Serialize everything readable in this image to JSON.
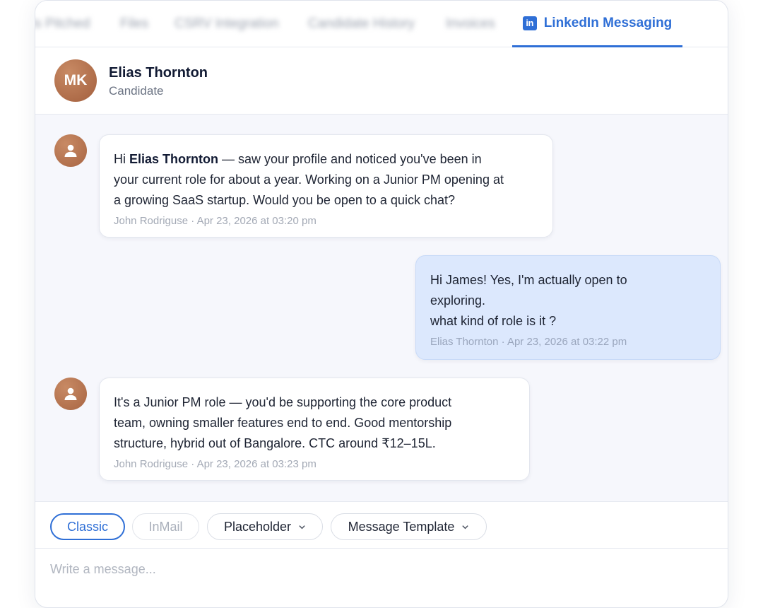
{
  "tabs": {
    "blurred": [
      {
        "label": "Is Pitched"
      },
      {
        "label": "Files"
      },
      {
        "label": "CSRV Integration"
      },
      {
        "label": "Candidate History"
      },
      {
        "label": "Invoices"
      }
    ],
    "active": {
      "label": "LinkedIn Messaging",
      "icon": "linkedin-icon",
      "icon_text": "in"
    }
  },
  "contact": {
    "initials": "MK",
    "name": "Elias Thornton",
    "role": "Candidate"
  },
  "messages": [
    {
      "direction": "incoming",
      "prefix": "Hi ",
      "bold": "Elias Thornton",
      "line1_rest": " — saw your profile and noticed you've been in",
      "line2": "your current role for about a year. Working on a Junior PM opening at",
      "line3": "a growing SaaS startup. Would you be open to a quick chat?",
      "meta": "John Rodriguse · Apr 23, 2026 at 03:20 pm"
    },
    {
      "direction": "outgoing",
      "line1": "Hi James! Yes, I'm actually open to",
      "line2": "exploring.",
      "line3": "what kind of role is it ?",
      "meta": "Elias Thornton · Apr 23, 2026 at 03:22 pm"
    },
    {
      "direction": "incoming",
      "line1": "It's a Junior PM role — you'd be supporting the core product",
      "line2": "team, owning smaller features end to end. Good mentorship",
      "line3": "structure, hybrid out of Bangalore. CTC around ₹12–15L.",
      "meta": "John Rodriguse · Apr 23, 2026 at 03:23 pm"
    }
  ],
  "toolbar": {
    "classic": "Classic",
    "inmail": "InMail",
    "placeholder": "Placeholder",
    "template": "Message Template"
  },
  "composer": {
    "placeholder": "Write a message..."
  },
  "colors": {
    "accent": "#2f6fd6",
    "outgoing_bubble": "#dce8fd",
    "avatar": "#b06a47"
  }
}
